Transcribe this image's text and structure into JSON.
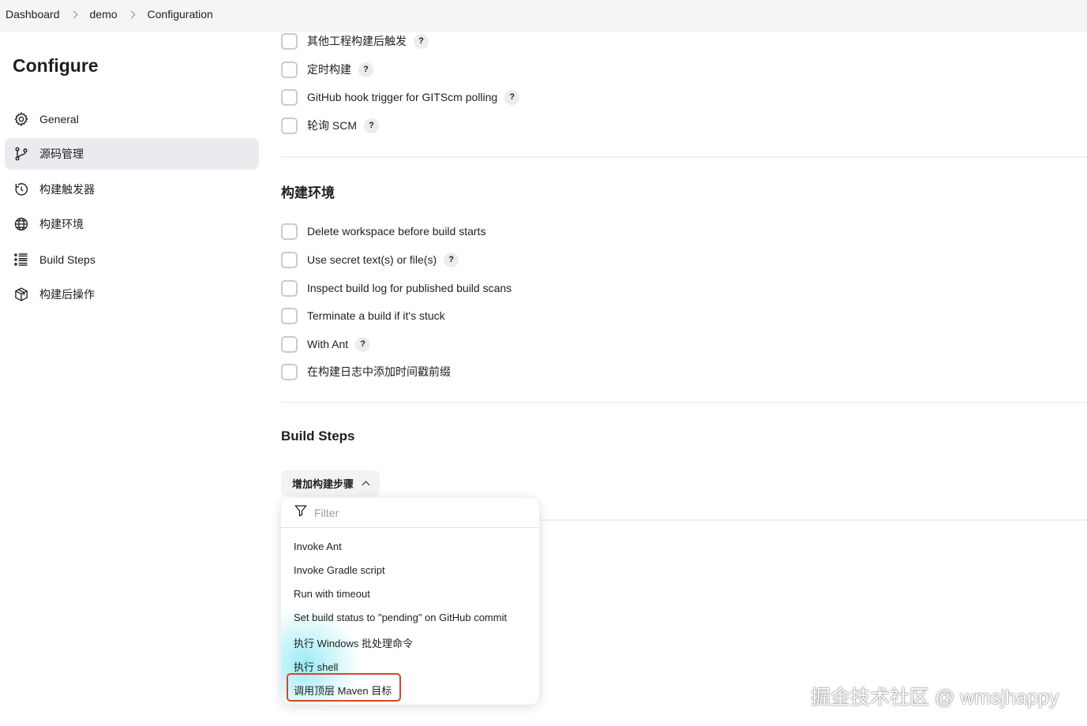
{
  "breadcrumb": [
    "Dashboard",
    "demo",
    "Configuration"
  ],
  "page_title": "Configure",
  "sidebar": {
    "items": [
      {
        "label": "General",
        "icon": "gear-icon"
      },
      {
        "label": "源码管理",
        "icon": "git-branch-icon"
      },
      {
        "label": "构建触发器",
        "icon": "clock-icon"
      },
      {
        "label": "构建环境",
        "icon": "globe-icon"
      },
      {
        "label": "Build Steps",
        "icon": "list-icon"
      },
      {
        "label": "构建后操作",
        "icon": "box-icon"
      }
    ],
    "active": "源码管理"
  },
  "triggers": {
    "options": [
      {
        "label": "其他工程构建后触发",
        "help": "?"
      },
      {
        "label": "定时构建",
        "help": "?"
      },
      {
        "label": "GitHub hook trigger for GITScm polling",
        "help": "?"
      },
      {
        "label": "轮询 SCM",
        "help": "?"
      }
    ]
  },
  "build_env": {
    "title": "构建环境",
    "options": [
      {
        "label": "Delete workspace before build starts",
        "help": ""
      },
      {
        "label": "Use secret text(s) or file(s)",
        "help": "?"
      },
      {
        "label": "Inspect build log for published build scans",
        "help": ""
      },
      {
        "label": "Terminate a build if it's stuck",
        "help": ""
      },
      {
        "label": "With Ant",
        "help": "?"
      },
      {
        "label": "在构建日志中添加时间戳前缀",
        "help": ""
      }
    ]
  },
  "build_steps": {
    "title": "Build Steps",
    "add_button": "增加构建步骤",
    "dropdown": {
      "filter_placeholder": "Filter",
      "items": [
        "Invoke Ant",
        "Invoke Gradle script",
        "Run with timeout",
        "Set build status to \"pending\" on GitHub commit",
        "执行 Windows 批处理命令",
        "执行 shell",
        "调用顶层 Maven 目标"
      ],
      "highlighted": "调用顶层 Maven 目标"
    }
  },
  "watermark": "掘金技术社区 @ wmsjhappy",
  "colors": {
    "highlight_border": "#d8452c",
    "active_nav_bg": "#eaebef",
    "topbar_bg": "#f5f5f7"
  }
}
